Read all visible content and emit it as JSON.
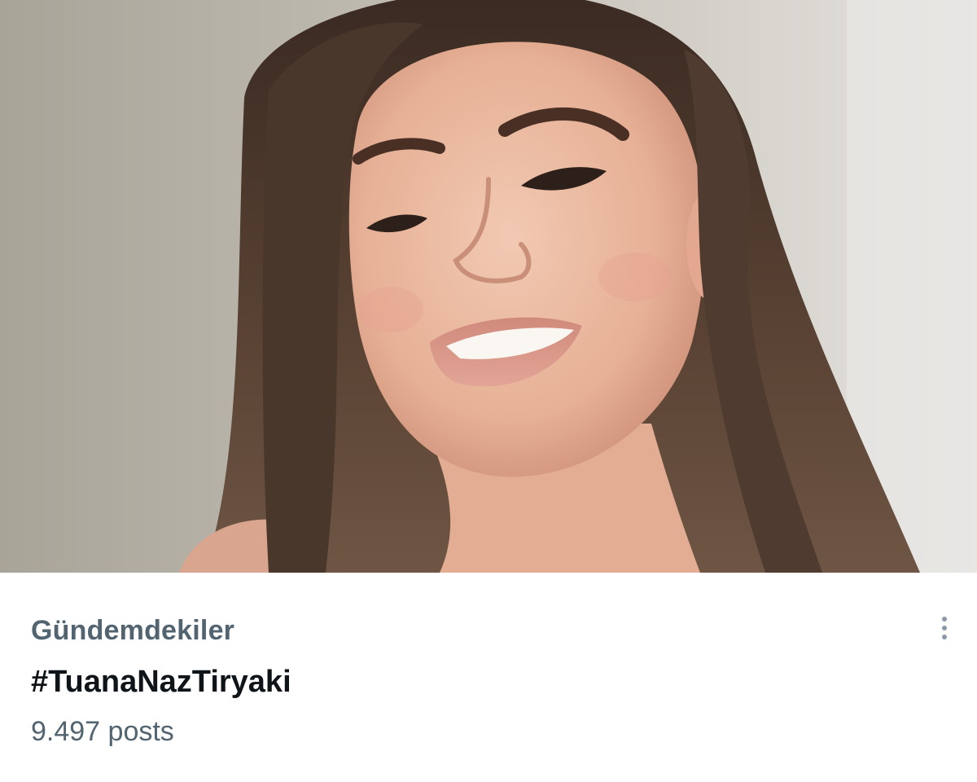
{
  "trend_card": {
    "category": "Gündemdekiler",
    "hashtag": "#TuanaNazTiryaki",
    "post_count": "9.497 posts",
    "more_icon": "more-vertical-icon"
  },
  "hero_image": {
    "subject": "smiling woman with long brown hair, selfie portrait",
    "icon": "photo"
  },
  "colors": {
    "secondary_text": "#536471",
    "primary_text": "#0f1419",
    "background": "#ffffff"
  }
}
